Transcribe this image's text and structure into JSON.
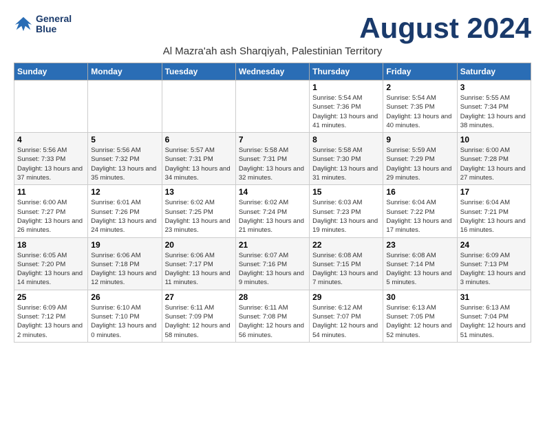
{
  "header": {
    "logo_line1": "General",
    "logo_line2": "Blue",
    "month_title": "August 2024",
    "subtitle": "Al Mazra'ah ash Sharqiyah, Palestinian Territory"
  },
  "weekdays": [
    "Sunday",
    "Monday",
    "Tuesday",
    "Wednesday",
    "Thursday",
    "Friday",
    "Saturday"
  ],
  "weeks": [
    [
      {
        "day": "",
        "sunrise": "",
        "sunset": "",
        "daylight": ""
      },
      {
        "day": "",
        "sunrise": "",
        "sunset": "",
        "daylight": ""
      },
      {
        "day": "",
        "sunrise": "",
        "sunset": "",
        "daylight": ""
      },
      {
        "day": "",
        "sunrise": "",
        "sunset": "",
        "daylight": ""
      },
      {
        "day": "1",
        "sunrise": "5:54 AM",
        "sunset": "7:36 PM",
        "daylight": "13 hours and 41 minutes."
      },
      {
        "day": "2",
        "sunrise": "5:54 AM",
        "sunset": "7:35 PM",
        "daylight": "13 hours and 40 minutes."
      },
      {
        "day": "3",
        "sunrise": "5:55 AM",
        "sunset": "7:34 PM",
        "daylight": "13 hours and 38 minutes."
      }
    ],
    [
      {
        "day": "4",
        "sunrise": "5:56 AM",
        "sunset": "7:33 PM",
        "daylight": "13 hours and 37 minutes."
      },
      {
        "day": "5",
        "sunrise": "5:56 AM",
        "sunset": "7:32 PM",
        "daylight": "13 hours and 35 minutes."
      },
      {
        "day": "6",
        "sunrise": "5:57 AM",
        "sunset": "7:31 PM",
        "daylight": "13 hours and 34 minutes."
      },
      {
        "day": "7",
        "sunrise": "5:58 AM",
        "sunset": "7:31 PM",
        "daylight": "13 hours and 32 minutes."
      },
      {
        "day": "8",
        "sunrise": "5:58 AM",
        "sunset": "7:30 PM",
        "daylight": "13 hours and 31 minutes."
      },
      {
        "day": "9",
        "sunrise": "5:59 AM",
        "sunset": "7:29 PM",
        "daylight": "13 hours and 29 minutes."
      },
      {
        "day": "10",
        "sunrise": "6:00 AM",
        "sunset": "7:28 PM",
        "daylight": "13 hours and 27 minutes."
      }
    ],
    [
      {
        "day": "11",
        "sunrise": "6:00 AM",
        "sunset": "7:27 PM",
        "daylight": "13 hours and 26 minutes."
      },
      {
        "day": "12",
        "sunrise": "6:01 AM",
        "sunset": "7:26 PM",
        "daylight": "13 hours and 24 minutes."
      },
      {
        "day": "13",
        "sunrise": "6:02 AM",
        "sunset": "7:25 PM",
        "daylight": "13 hours and 23 minutes."
      },
      {
        "day": "14",
        "sunrise": "6:02 AM",
        "sunset": "7:24 PM",
        "daylight": "13 hours and 21 minutes."
      },
      {
        "day": "15",
        "sunrise": "6:03 AM",
        "sunset": "7:23 PM",
        "daylight": "13 hours and 19 minutes."
      },
      {
        "day": "16",
        "sunrise": "6:04 AM",
        "sunset": "7:22 PM",
        "daylight": "13 hours and 17 minutes."
      },
      {
        "day": "17",
        "sunrise": "6:04 AM",
        "sunset": "7:21 PM",
        "daylight": "13 hours and 16 minutes."
      }
    ],
    [
      {
        "day": "18",
        "sunrise": "6:05 AM",
        "sunset": "7:20 PM",
        "daylight": "13 hours and 14 minutes."
      },
      {
        "day": "19",
        "sunrise": "6:06 AM",
        "sunset": "7:18 PM",
        "daylight": "13 hours and 12 minutes."
      },
      {
        "day": "20",
        "sunrise": "6:06 AM",
        "sunset": "7:17 PM",
        "daylight": "13 hours and 11 minutes."
      },
      {
        "day": "21",
        "sunrise": "6:07 AM",
        "sunset": "7:16 PM",
        "daylight": "13 hours and 9 minutes."
      },
      {
        "day": "22",
        "sunrise": "6:08 AM",
        "sunset": "7:15 PM",
        "daylight": "13 hours and 7 minutes."
      },
      {
        "day": "23",
        "sunrise": "6:08 AM",
        "sunset": "7:14 PM",
        "daylight": "13 hours and 5 minutes."
      },
      {
        "day": "24",
        "sunrise": "6:09 AM",
        "sunset": "7:13 PM",
        "daylight": "13 hours and 3 minutes."
      }
    ],
    [
      {
        "day": "25",
        "sunrise": "6:09 AM",
        "sunset": "7:12 PM",
        "daylight": "13 hours and 2 minutes."
      },
      {
        "day": "26",
        "sunrise": "6:10 AM",
        "sunset": "7:10 PM",
        "daylight": "13 hours and 0 minutes."
      },
      {
        "day": "27",
        "sunrise": "6:11 AM",
        "sunset": "7:09 PM",
        "daylight": "12 hours and 58 minutes."
      },
      {
        "day": "28",
        "sunrise": "6:11 AM",
        "sunset": "7:08 PM",
        "daylight": "12 hours and 56 minutes."
      },
      {
        "day": "29",
        "sunrise": "6:12 AM",
        "sunset": "7:07 PM",
        "daylight": "12 hours and 54 minutes."
      },
      {
        "day": "30",
        "sunrise": "6:13 AM",
        "sunset": "7:05 PM",
        "daylight": "12 hours and 52 minutes."
      },
      {
        "day": "31",
        "sunrise": "6:13 AM",
        "sunset": "7:04 PM",
        "daylight": "12 hours and 51 minutes."
      }
    ]
  ]
}
